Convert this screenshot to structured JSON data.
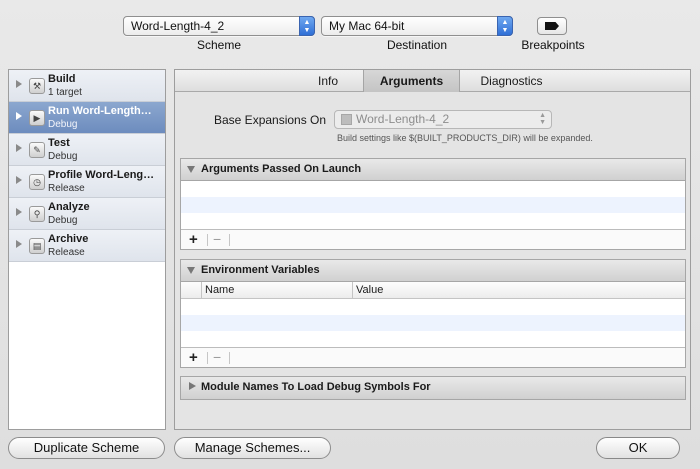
{
  "toolbar": {
    "scheme_value": "Word-Length-4_2",
    "scheme_label": "Scheme",
    "destination_value": "My Mac 64-bit",
    "destination_label": "Destination",
    "breakpoints_label": "Breakpoints"
  },
  "actions": [
    {
      "name": "Build",
      "sub": "1 target"
    },
    {
      "name": "Run Word-Length…",
      "sub": "Debug"
    },
    {
      "name": "Test",
      "sub": "Debug"
    },
    {
      "name": "Profile Word-Leng…",
      "sub": "Release"
    },
    {
      "name": "Analyze",
      "sub": "Debug"
    },
    {
      "name": "Archive",
      "sub": "Release"
    }
  ],
  "tabs": [
    "Info",
    "Arguments",
    "Diagnostics"
  ],
  "arguments": {
    "base_label": "Base Expansions On",
    "base_value": "Word-Length-4_2",
    "base_hint": "Build settings like $(BUILT_PRODUCTS_DIR) will be expanded.",
    "launch_title": "Arguments Passed On Launch",
    "env_title": "Environment Variables",
    "env_col_name": "Name",
    "env_col_value": "Value",
    "module_title": "Module Names To Load Debug Symbols For",
    "add_symbol": "+",
    "remove_symbol": "−"
  },
  "buttons": {
    "duplicate": "Duplicate Scheme",
    "manage": "Manage Schemes...",
    "ok": "OK"
  },
  "colors": {
    "selection": "#6d8cbe",
    "popup_accent": "#2f6fd6",
    "alt_row": "#edf3fe"
  }
}
